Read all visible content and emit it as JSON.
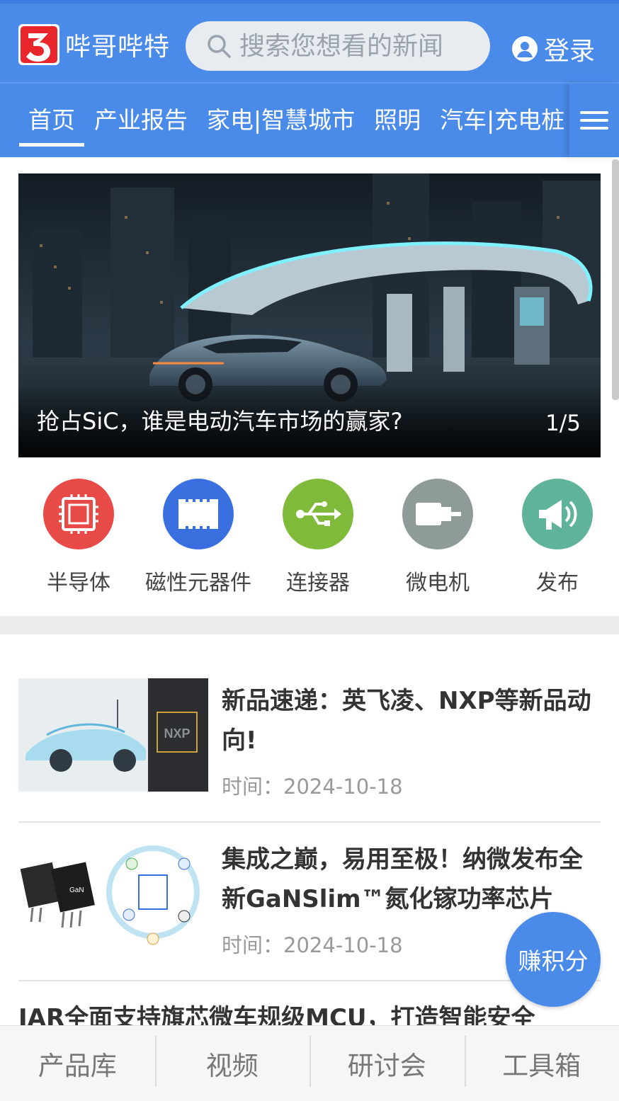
{
  "header": {
    "site_name": "哔哥哔特",
    "logo_icon": "logo-3-icon",
    "search_placeholder": "搜索您想看的新闻",
    "login_label": "登录"
  },
  "nav": {
    "items": [
      {
        "label": "首页",
        "active": true
      },
      {
        "label": "产业报告",
        "active": false
      },
      {
        "label": "家电|智慧城市",
        "active": false
      },
      {
        "label": "照明",
        "active": false
      },
      {
        "label": "汽车|充电桩",
        "active": false
      }
    ],
    "menu_icon": "hamburger-icon"
  },
  "banner": {
    "title": "抢占SiC，谁是电动汽车市场的赢家?",
    "counter": "1/5"
  },
  "categories": [
    {
      "label": "半导体",
      "icon": "chip-icon",
      "color": "#e84a47"
    },
    {
      "label": "磁性元器件",
      "icon": "magnetic-component-icon",
      "color": "#3a6fe0"
    },
    {
      "label": "连接器",
      "icon": "usb-icon",
      "color": "#7fba3b"
    },
    {
      "label": "微电机",
      "icon": "motor-icon",
      "color": "#8f9b98"
    },
    {
      "label": "发布",
      "icon": "megaphone-icon",
      "color": "#5fb39b"
    }
  ],
  "news": [
    {
      "title": "新品速递：英飞凌、NXP等新品动向!",
      "time": "时间：2024-10-18"
    },
    {
      "title": "集成之巅，易用至极！纳微发布全新GaNSlim™氮化镓功率芯片",
      "time": "时间：2024-10-18"
    },
    {
      "title": "IAR全面支持旗芯微车规级MCU，打造智能安全"
    }
  ],
  "float_button": {
    "label": "赚积分"
  },
  "bottom_bar": {
    "items": [
      "产品库",
      "视频",
      "研讨会",
      "工具箱"
    ]
  },
  "colors": {
    "brand_blue": "#4a8bea",
    "logo_red": "#e8262c"
  }
}
